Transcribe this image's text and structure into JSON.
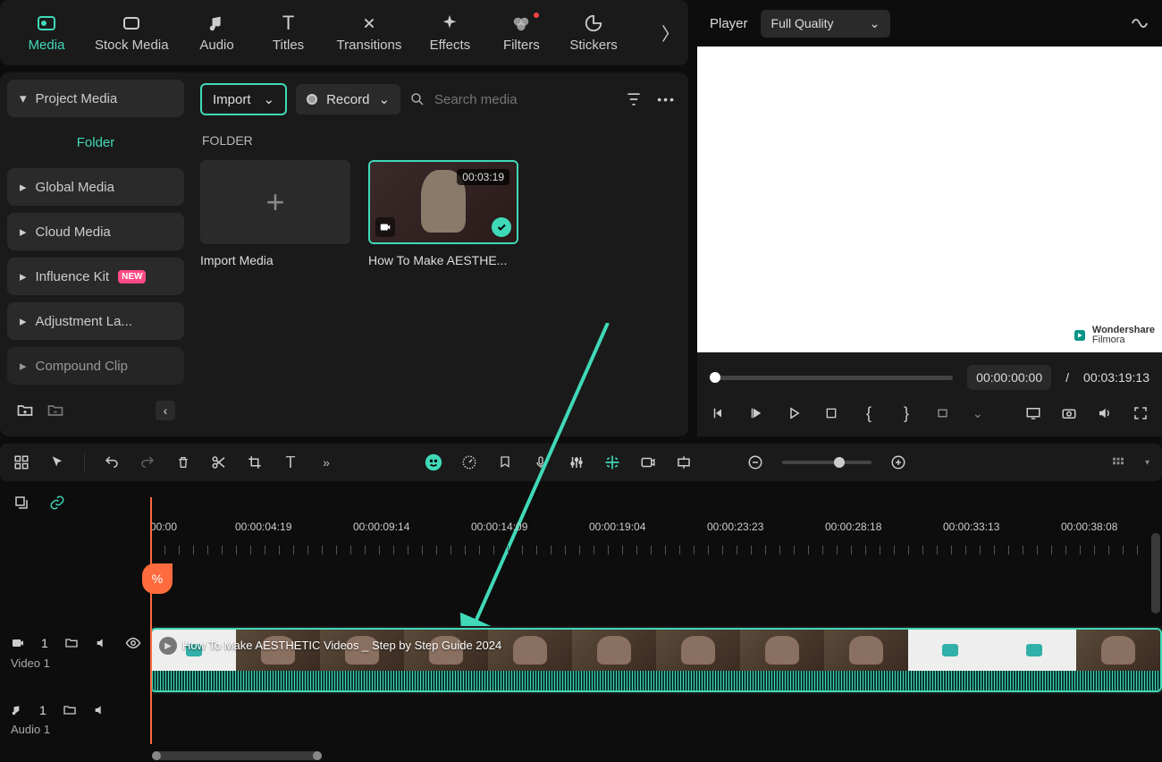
{
  "topTabs": [
    {
      "label": "Media",
      "icon": "media"
    },
    {
      "label": "Stock Media",
      "icon": "stock"
    },
    {
      "label": "Audio",
      "icon": "audio"
    },
    {
      "label": "Titles",
      "icon": "titles"
    },
    {
      "label": "Transitions",
      "icon": "transitions"
    },
    {
      "label": "Effects",
      "icon": "effects"
    },
    {
      "label": "Filters",
      "icon": "filters"
    },
    {
      "label": "Stickers",
      "icon": "stickers"
    }
  ],
  "sidebar": {
    "projectMedia": "Project Media",
    "folder": "Folder",
    "items": [
      "Global Media",
      "Cloud Media",
      "Influence Kit",
      "Adjustment La...",
      "Compound Clip"
    ],
    "newBadge": "NEW"
  },
  "mediaToolbar": {
    "import": "Import",
    "record": "Record",
    "searchPlaceholder": "Search media"
  },
  "folderSection": {
    "label": "FOLDER",
    "cards": [
      {
        "caption": "Import Media"
      },
      {
        "caption": "How To Make AESTHE...",
        "duration": "00:03:19"
      }
    ]
  },
  "player": {
    "label": "Player",
    "quality": "Full Quality",
    "currentTime": "00:00:00:00",
    "totalTime": "00:03:19:13",
    "sep": "/",
    "logoTop": "Wondershare",
    "logoBottom": "Filmora"
  },
  "ruler": {
    "ticks": [
      "00:00",
      "00:00:04:19",
      "00:00:09:14",
      "00:00:14:09",
      "00:00:19:04",
      "00:00:23:23",
      "00:00:28:18",
      "00:00:33:13",
      "00:00:38:08"
    ]
  },
  "tracks": {
    "video1": "Video 1",
    "videoNum": "1",
    "audio1": "Audio 1",
    "audioNum": "1",
    "clipTitle": "How To Make AESTHETIC Videos _ Step by Step Guide 2024"
  }
}
